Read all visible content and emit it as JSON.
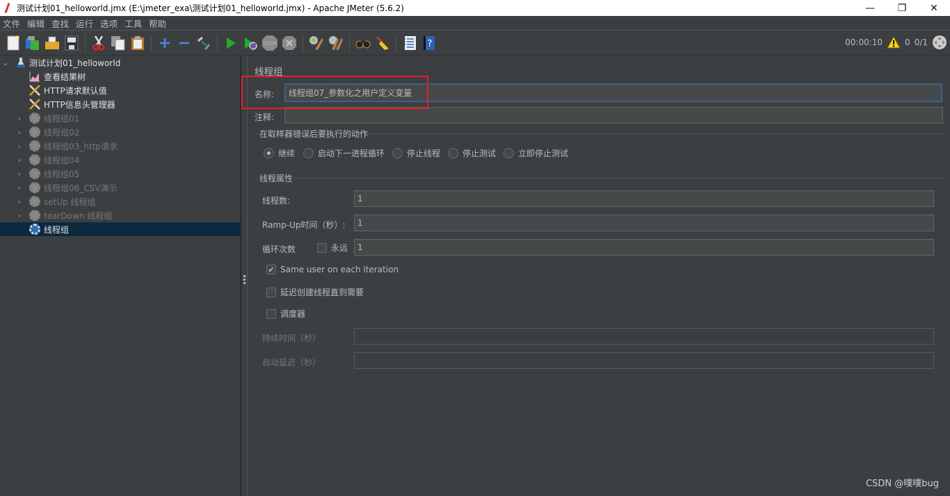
{
  "window": {
    "title": "测试计划01_helloworld.jmx (E:\\jmeter_exa\\测试计划01_helloworld.jmx) - Apache JMeter (5.6.2)",
    "minimize": "—",
    "restore": "❐",
    "close": "✕"
  },
  "menu": [
    "文件",
    "编辑",
    "查找",
    "运行",
    "选项",
    "工具",
    "帮助"
  ],
  "toolbar": {
    "buttons": [
      "new-icon",
      "templates-icon",
      "open-icon",
      "save-icon",
      "cut-icon",
      "copy-icon",
      "paste-icon",
      "expand-all-icon",
      "collapse-all-icon",
      "toggle-icon",
      "start-icon",
      "start-no-pauses-icon",
      "stop-icon",
      "shutdown-icon",
      "clear-icon",
      "clear-all-icon",
      "search-icon",
      "reset-search-icon",
      "function-helper-icon",
      "help-icon"
    ]
  },
  "status": {
    "elapsed": "00:00:10",
    "warnings": "0",
    "threads": "0/1"
  },
  "tree": {
    "root": "测试计划01_helloworld",
    "items": [
      {
        "label": "查看结果树",
        "type": "listener",
        "expandable": false,
        "enabled": true
      },
      {
        "label": "HTTP请求默认值",
        "type": "config",
        "expandable": false,
        "enabled": true
      },
      {
        "label": "HTTP信息头管理器",
        "type": "config",
        "expandable": false,
        "enabled": true
      },
      {
        "label": "线程组01",
        "type": "thread-group",
        "expandable": true,
        "enabled": false
      },
      {
        "label": "线程组02",
        "type": "thread-group",
        "expandable": true,
        "enabled": false
      },
      {
        "label": "线程组03_http请求",
        "type": "thread-group",
        "expandable": true,
        "enabled": false
      },
      {
        "label": "线程组04",
        "type": "thread-group",
        "expandable": true,
        "enabled": false
      },
      {
        "label": "线程组05",
        "type": "thread-group",
        "expandable": true,
        "enabled": false
      },
      {
        "label": "线程组06_CSV演示",
        "type": "thread-group",
        "expandable": true,
        "enabled": false
      },
      {
        "label": "setUp 线程组",
        "type": "thread-group",
        "expandable": true,
        "enabled": false
      },
      {
        "label": "tearDown 线程组",
        "type": "thread-group",
        "expandable": true,
        "enabled": false
      },
      {
        "label": "线程组",
        "type": "thread-group",
        "expandable": false,
        "enabled": true,
        "selected": true
      }
    ]
  },
  "panel": {
    "title": "线程组",
    "name_label": "名称:",
    "name_value": "线程组07_参数化之用户定义变量",
    "comment_label": "注释:",
    "comment_value": "",
    "error_action": {
      "title": "在取样器错误后要执行的动作",
      "options": [
        "继续",
        "启动下一进程循环",
        "停止线程",
        "停止测试",
        "立即停止测试"
      ],
      "selected": "继续"
    },
    "thread_props": {
      "title": "线程属性",
      "threads_label": "线程数:",
      "threads_value": "1",
      "rampup_label": "Ramp-Up时间（秒）:",
      "rampup_value": "1",
      "loop_label": "循环次数",
      "forever_label": "永远",
      "forever_checked": false,
      "loop_value": "1",
      "same_user_label": "Same user on each iteration",
      "same_user_checked": true,
      "delay_label": "延迟创建线程直到需要",
      "delay_checked": false,
      "scheduler_label": "调度器",
      "scheduler_checked": false,
      "duration_label": "持续时间（秒）",
      "duration_value": "",
      "startup_delay_label": "启动延迟（秒）",
      "startup_delay_value": ""
    }
  },
  "watermark": "CSDN @噗噗bug",
  "colors": {
    "background": "#3c3f41",
    "selection": "#0d293e",
    "focus_border": "#3d6185",
    "highlight_annotation": "#e2202a"
  }
}
